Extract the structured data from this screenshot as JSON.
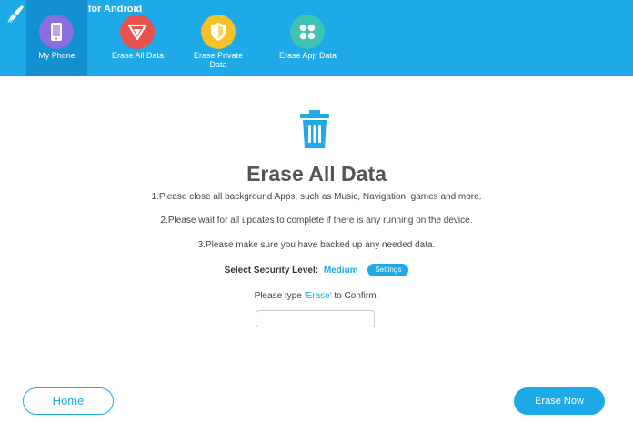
{
  "app": {
    "title": "SafeWiper for Android",
    "logo_icon": "broom-icon"
  },
  "nav": {
    "tabs": [
      {
        "label": "My Phone",
        "icon": "phone-icon",
        "color": "#8b6fe0",
        "active": true
      },
      {
        "label": "Erase All Data",
        "icon": "erase-all-icon",
        "color": "#e8514c",
        "active": false
      },
      {
        "label": "Erase Private Data",
        "icon": "shield-icon",
        "color": "#f4c22b",
        "active": false
      },
      {
        "label": "Erase App Data",
        "icon": "apps-grid-icon",
        "color": "#3ec4b4",
        "active": false
      }
    ]
  },
  "main": {
    "title": "Erase All Data",
    "trash_icon": "trash-icon",
    "instructions": [
      "1.Please close all background Apps, such as Music, Navigation, games and more.",
      "2.Please wait for all updates to complete if there is any running on the device.",
      "3.Please make sure you have backed up any needed data."
    ],
    "security": {
      "label": "Select Security Level:",
      "value": "Medium",
      "settings_label": "Settings"
    },
    "confirm": {
      "prefix": "Please type ",
      "word": "'Erase'",
      "suffix": " to Confirm.",
      "input_value": "",
      "input_placeholder": ""
    }
  },
  "footer": {
    "home_label": "Home",
    "erase_now_label": "Erase Now"
  },
  "colors": {
    "accent": "#1ea9e8",
    "header_active": "#1390cf"
  }
}
